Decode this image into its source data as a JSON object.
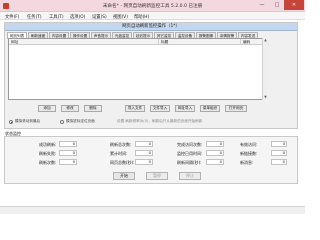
{
  "window": {
    "title": "未命名* - 网页自动刷新监控工具 5.2.0.0 已注册",
    "minimize_glyph": "—",
    "maximize_glyph": "□",
    "close_glyph": "✕"
  },
  "menu": [
    "文件(F)",
    "任务(T)",
    "工具(T)",
    "选项(O)",
    "设置(S)",
    "视图(V)",
    "帮助(H)"
  ],
  "panel": {
    "title": "网页自动刷新监控操作（1*）",
    "tabs": [
      "网页列表",
      "刷新速度",
      "内容设置",
      "操作设置",
      "声音提示",
      "光盘监控",
      "延迟提示",
      "其它监控",
      "监控设备",
      "报警图像",
      "亲情报警",
      "内容发送"
    ]
  },
  "list": {
    "columns": [
      "网址",
      "标题",
      "编码"
    ],
    "scroll_up_glyph": "▲",
    "scroll_down_glyph": "▼"
  },
  "buttons": {
    "add": "添加",
    "edit": "修改",
    "delete": "删除",
    "import_list": "导入文件",
    "export_list": "文件导入",
    "move_up": "网址导入",
    "move_down": "菜单组织",
    "open_page": "打开网页"
  },
  "options": {
    "opt1": "模拟滚动到最后",
    "opt2": "模拟鼠标定位页面",
    "hint": "设置 刷新频率为(0)，刷新后只从最新的页面开始刷新"
  },
  "status": {
    "title": "状态监控",
    "rows": [
      [
        {
          "label": "成功刷新:",
          "value": "0"
        },
        {
          "label": "刷新总次数:",
          "value": "0"
        },
        {
          "label": "完成访问次数:",
          "value": "0"
        },
        {
          "label": "有效访问:",
          "value": "0"
        }
      ],
      [
        {
          "label": "刷新失败:",
          "value": "0"
        },
        {
          "label": "累计时间:",
          "value": "0"
        },
        {
          "label": "监控已用时间:",
          "value": "0"
        },
        {
          "label": "新链接数:",
          "value": "0"
        }
      ],
      [
        {
          "label": "刷新次数:",
          "value": "0"
        },
        {
          "label": "网页总数(秒):",
          "value": "0"
        },
        {
          "label": "刷新间隔(秒):",
          "value": "0"
        },
        {
          "label": "新消息:",
          "value": "0"
        }
      ]
    ]
  },
  "controls": {
    "start": "开始",
    "pause": "暂停",
    "stop": "停止"
  }
}
